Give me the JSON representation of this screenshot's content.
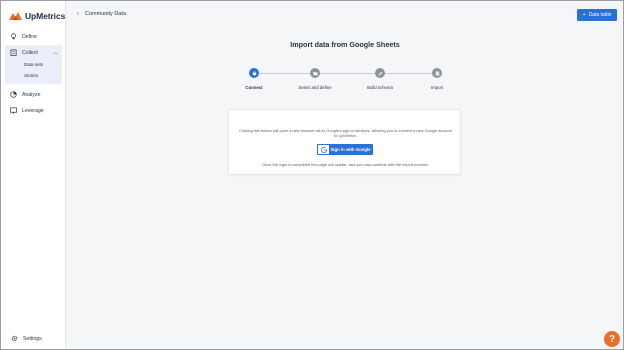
{
  "brand": {
    "name": "UpMetrics",
    "color": "#e8702a"
  },
  "sidebar": {
    "items": [
      {
        "label": "Define",
        "icon": "lightbulb-icon"
      },
      {
        "label": "Collect",
        "icon": "clipboard-icon"
      },
      {
        "label": "Analyze",
        "icon": "chart-icon"
      },
      {
        "label": "Leverage",
        "icon": "presentation-icon"
      }
    ],
    "collect_sub": [
      {
        "label": "Data sets"
      },
      {
        "label": "Stories"
      }
    ],
    "settings_label": "Settings"
  },
  "topbar": {
    "back_label": "Community Data",
    "action_label": "Data table",
    "action_icon": "plus-icon"
  },
  "main": {
    "title": "Import data from Google Sheets",
    "steps": [
      {
        "label": "Connect",
        "active": true,
        "icon": "plug-icon"
      },
      {
        "label": "Select and define",
        "active": false,
        "icon": "folder-icon"
      },
      {
        "label": "Build schema",
        "active": false,
        "icon": "pencil-icon"
      },
      {
        "label": "Import",
        "active": false,
        "icon": "sheet-icon"
      }
    ],
    "card": {
      "description": "Clicking this button will open a new browser tab to Google's sign-in services, allowing you to connect a new Google account to UpMetrics.",
      "google_button": "Sign in with Google",
      "note": "Once the login is completed this page will update, and you may continue with the import process."
    }
  },
  "colors": {
    "accent": "#2c6fd6",
    "help": "#e8702a"
  },
  "help_label": "?"
}
